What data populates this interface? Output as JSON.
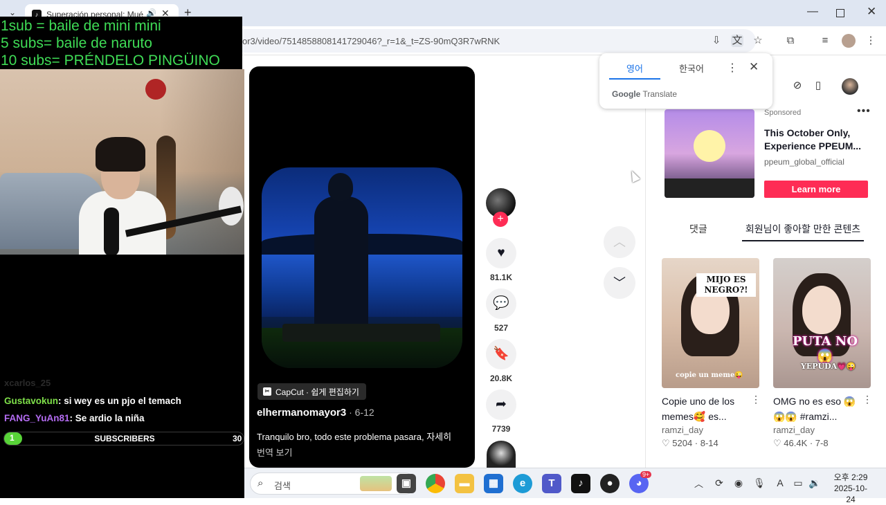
{
  "browser": {
    "tab_title": "Superación personal: Mué",
    "url": "or3/video/7514858808141729046?_r=1&_t=ZS-90mQ3R7wRNK"
  },
  "translate_popup": {
    "tab_source": "영어",
    "tab_target": "한국어",
    "footer": "Translate",
    "footer_brand": "Google"
  },
  "stream_overlay": {
    "goals": [
      "1sub = baile de mini mini",
      "5 subs= baile de naruto",
      "10 subs= PRÉNDELO PINGÜINO"
    ],
    "chat_faded": "xcarlos_25",
    "chat": [
      {
        "user": "Gustavokun",
        "message": ": si wey es un pjo el temach",
        "color": "#7fe04a"
      },
      {
        "user": "FANG_YuAn81",
        "message": ": Se ardio la niña",
        "color": "#b46cf2"
      }
    ],
    "subbar": {
      "current": "1",
      "label": "SUBSCRIBERS",
      "goal": "30",
      "progress": 0.033
    }
  },
  "video": {
    "capcut_label": "CapCut · 쉽게 편집하기",
    "author": "elhermanomayor3",
    "date": " · 6-12",
    "caption": "Tranquilo bro, todo este problema pasara,  자세히",
    "see_translation": "번역 보기"
  },
  "actions": {
    "likes": "81.1K",
    "comments": "527",
    "saves": "20.8K",
    "shares": "7739"
  },
  "ad": {
    "sponsored": "Sponsored",
    "title": "This October Only, Experience PPEUM...",
    "handle": "ppeum_global_official",
    "cta": "Learn more"
  },
  "side_tabs": {
    "comments": "댓글",
    "recommended": "회원님이 좋아할 만한 콘텐츠"
  },
  "recommended": [
    {
      "overlay": "MIJO ES NEGRO?!",
      "bottom": "copie un meme😜",
      "title": "Copie uno de los memes🥰 es...",
      "user": "ramzi_day",
      "likes": "♡ 5204",
      "date": " · 8-14"
    },
    {
      "overlay": "PUTA NO😱",
      "bottom": "YEPUDA💗😜",
      "title": "OMG no es eso 😱 😱😱 #ramzi...",
      "user": "ramzi_day",
      "likes": "♡ 46.4K",
      "date": " · 7-8"
    }
  ],
  "taskbar": {
    "search_placeholder": "검색",
    "time": "오후 2:29",
    "date": "2025-10-24",
    "notification_badge": "9+"
  },
  "colors": {
    "accent": "#fe2c55",
    "overlay_green": "#3fdc56",
    "subbar_fill": "#58d338"
  }
}
